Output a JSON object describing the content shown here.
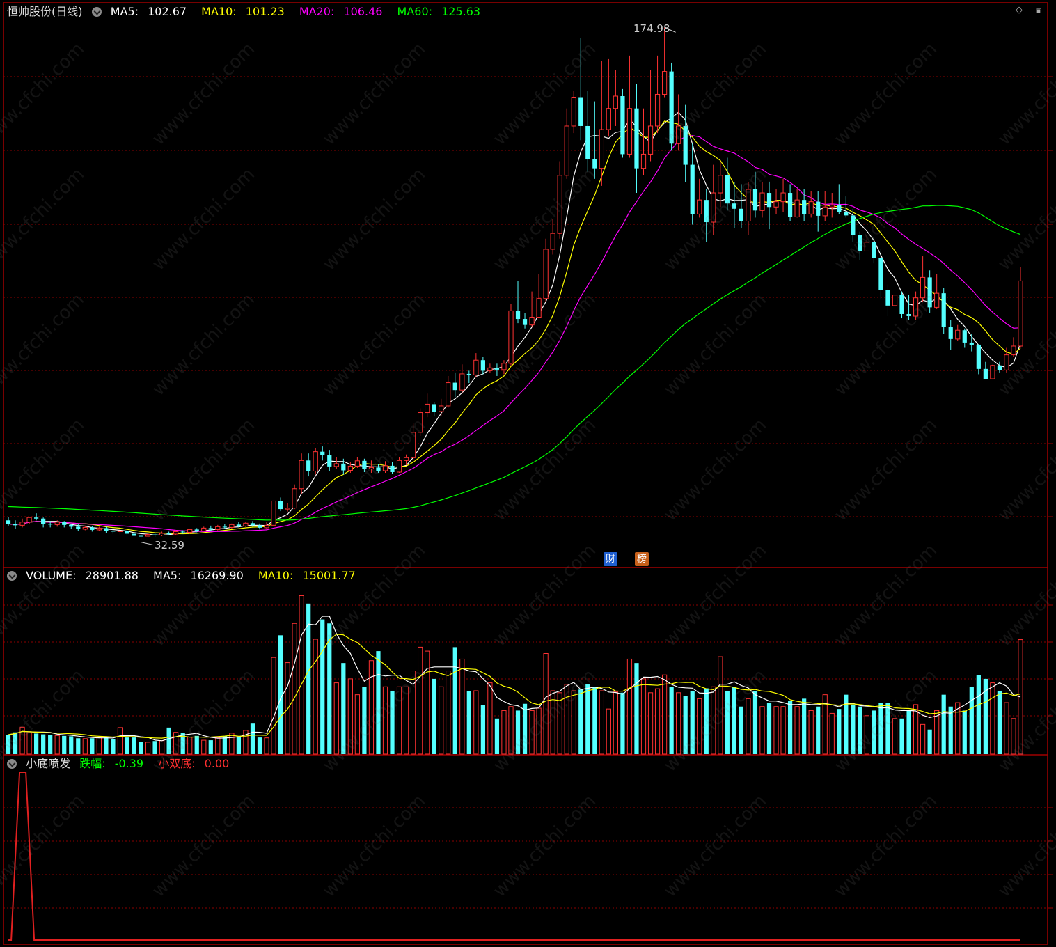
{
  "stock": {
    "title": "恒帅股份(日线)"
  },
  "price_legend": [
    {
      "label": "MA5: ",
      "value": "102.67",
      "color": "#ffffff"
    },
    {
      "label": "MA10: ",
      "value": "101.23",
      "color": "#ffff00"
    },
    {
      "label": "MA20: ",
      "value": "106.46",
      "color": "#ff00ff"
    },
    {
      "label": "MA60: ",
      "value": "125.63",
      "color": "#00ff00"
    }
  ],
  "volume_legend": [
    {
      "label": "VOLUME: ",
      "value": "28901.88",
      "color": "#ffffff"
    },
    {
      "label": "MA5: ",
      "value": "16269.90",
      "color": "#ffffff"
    },
    {
      "label": "MA10: ",
      "value": "15001.77",
      "color": "#ffff00"
    }
  ],
  "indicator_legend": {
    "name": "小底喷发",
    "items": [
      {
        "label": "跌幅: ",
        "value": "-0.39",
        "color": "#00ff00"
      },
      {
        "label": "小双底: ",
        "value": "0.00",
        "color": "#ff3030"
      }
    ]
  },
  "annotations": {
    "high": "174.98",
    "low": "32.59"
  },
  "badges": [
    {
      "text": "财",
      "color": "#1f5fd0"
    },
    {
      "text": "榜",
      "color": "#c8601a"
    }
  ],
  "watermark": "www.cfchi.com",
  "colors": {
    "up": "#ff3232",
    "down": "#54ffff",
    "grid": "#8b0000",
    "frame": "#a00000"
  },
  "chart_data": {
    "type": "candlestick",
    "price_range": [
      25,
      185
    ],
    "candles": [
      [
        38,
        37,
        39,
        36.5
      ],
      [
        37,
        36.6,
        38,
        35.5
      ],
      [
        36.6,
        37.5,
        38.5,
        36
      ],
      [
        37.5,
        38.8,
        39,
        37
      ],
      [
        38.8,
        38.5,
        40,
        38
      ],
      [
        38.5,
        37,
        38.8,
        36
      ],
      [
        37,
        36.8,
        37.8,
        36
      ],
      [
        36.8,
        37.5,
        38,
        36.2
      ],
      [
        37.5,
        36.7,
        37.8,
        36
      ],
      [
        36.7,
        36.2,
        37,
        35.5
      ],
      [
        36.2,
        35.5,
        37,
        35
      ],
      [
        35.5,
        36,
        36.5,
        35.2
      ],
      [
        36,
        35.3,
        36.4,
        34.8
      ],
      [
        35.3,
        35.8,
        36.2,
        34.9
      ],
      [
        35.8,
        35,
        36.2,
        34.5
      ],
      [
        35,
        34.8,
        35.8,
        34.2
      ],
      [
        34.8,
        35,
        35.5,
        34
      ],
      [
        35,
        34.2,
        35.2,
        33.8
      ],
      [
        34.2,
        33.6,
        34.6,
        33
      ],
      [
        33.6,
        33.5,
        34,
        32.59
      ],
      [
        33.5,
        34,
        34.5,
        33
      ],
      [
        34,
        33.8,
        34.6,
        33.3
      ],
      [
        33.8,
        34.3,
        34.8,
        33.5
      ],
      [
        34.3,
        34.1,
        34.8,
        33.8
      ],
      [
        34.1,
        34.8,
        35.2,
        33.8
      ],
      [
        34.8,
        34.6,
        35.2,
        34.2
      ],
      [
        34.6,
        35.4,
        35.6,
        34.2
      ],
      [
        35.4,
        35,
        35.8,
        34.6
      ],
      [
        35,
        35.8,
        36.2,
        34.8
      ],
      [
        35.8,
        35.4,
        36.5,
        35
      ],
      [
        35.4,
        36.2,
        36.7,
        35.1
      ],
      [
        36.2,
        36,
        37,
        35.5
      ],
      [
        36,
        36.8,
        37.1,
        35.7
      ],
      [
        36.8,
        36.4,
        37.5,
        36
      ],
      [
        36.4,
        37.2,
        37.6,
        36.1
      ],
      [
        37.2,
        36.6,
        37.8,
        36.2
      ],
      [
        36.6,
        35.9,
        37.1,
        35.4
      ],
      [
        35.9,
        36.6,
        37.5,
        35.5
      ],
      [
        36.6,
        43.5,
        43.5,
        36.6
      ],
      [
        43.5,
        41.2,
        44.5,
        40.6
      ],
      [
        41.2,
        41.5,
        42.8,
        40.5
      ],
      [
        41.5,
        47,
        48.2,
        41.2
      ],
      [
        47,
        55,
        57,
        45.5
      ],
      [
        55,
        52,
        57,
        50.5
      ],
      [
        52,
        57.5,
        58.5,
        51
      ],
      [
        57.5,
        56.5,
        59,
        55
      ],
      [
        56.5,
        53.3,
        58,
        52
      ],
      [
        53.3,
        54.1,
        56,
        52.5
      ],
      [
        54.1,
        52.2,
        55.5,
        51
      ],
      [
        52.2,
        53.4,
        54.5,
        51.5
      ],
      [
        53.4,
        54.9,
        56,
        52.9
      ],
      [
        54.9,
        52.6,
        55.5,
        51.7
      ],
      [
        52.6,
        53,
        55,
        51.5
      ],
      [
        53,
        52.1,
        54,
        51.5
      ],
      [
        52.1,
        53.5,
        54.8,
        51.5
      ],
      [
        53.5,
        51.7,
        54.5,
        51.2
      ],
      [
        51.7,
        55,
        56,
        51.5
      ],
      [
        55,
        55.8,
        56.7,
        53.7
      ],
      [
        55.8,
        63,
        65.5,
        55
      ],
      [
        63,
        68.6,
        69.8,
        62
      ],
      [
        68.6,
        71,
        74,
        67.3
      ],
      [
        71,
        68.9,
        71.5,
        67.5
      ],
      [
        68.9,
        70.5,
        72.5,
        67.5
      ],
      [
        70.5,
        77.1,
        79,
        70
      ],
      [
        77.1,
        75,
        80,
        73
      ],
      [
        75,
        79.6,
        82.3,
        74
      ],
      [
        79.6,
        79.3,
        80.5,
        77
      ],
      [
        79.3,
        83.5,
        85.5,
        78.8
      ],
      [
        83.5,
        80.5,
        84.5,
        79.5
      ],
      [
        80.5,
        81.3,
        82.5,
        80
      ],
      [
        81.3,
        80.8,
        82.5,
        79
      ],
      [
        80.8,
        82.6,
        83.5,
        79.5
      ],
      [
        82.6,
        97.5,
        99.5,
        82
      ],
      [
        97.5,
        95.2,
        106,
        94
      ],
      [
        95.2,
        93.5,
        96.8,
        92.5
      ],
      [
        93.5,
        95.7,
        103,
        93
      ],
      [
        95.7,
        101,
        108,
        95.5
      ],
      [
        101,
        115,
        118,
        100
      ],
      [
        115,
        119.5,
        123.5,
        113.5
      ],
      [
        119.5,
        136,
        140,
        118
      ],
      [
        136,
        150,
        155,
        135
      ],
      [
        150,
        158,
        160,
        148
      ],
      [
        158,
        150,
        175,
        146
      ],
      [
        150,
        140.5,
        160,
        137
      ],
      [
        140.5,
        138,
        157,
        135
      ],
      [
        138,
        149,
        168.5,
        133
      ],
      [
        149,
        155,
        169,
        147
      ],
      [
        155,
        158.5,
        166,
        150
      ],
      [
        158.5,
        142,
        160.5,
        141
      ],
      [
        142,
        155,
        170,
        141
      ],
      [
        155,
        138,
        162,
        131
      ],
      [
        138,
        142,
        155,
        136
      ],
      [
        142,
        150,
        166,
        140
      ],
      [
        150,
        159,
        170,
        148
      ],
      [
        159,
        165.5,
        178,
        158
      ],
      [
        165.5,
        145,
        168,
        143
      ],
      [
        145,
        150,
        159,
        143
      ],
      [
        150,
        139,
        156,
        134
      ],
      [
        139,
        125,
        145,
        122
      ],
      [
        125,
        129,
        135,
        124
      ],
      [
        129,
        122.7,
        132,
        117
      ],
      [
        122.7,
        131,
        139,
        119
      ],
      [
        131,
        136,
        140,
        127
      ],
      [
        136,
        128,
        141,
        126
      ],
      [
        128,
        126.5,
        134,
        121
      ],
      [
        126.5,
        123,
        133.5,
        121
      ],
      [
        123,
        132,
        134,
        119
      ],
      [
        132,
        126,
        137,
        124
      ],
      [
        126,
        131,
        134,
        124
      ],
      [
        131,
        127,
        134.2,
        120.7
      ],
      [
        127,
        128.5,
        132,
        125
      ],
      [
        128.5,
        131,
        135,
        125.5
      ],
      [
        131,
        124.2,
        133.5,
        123
      ],
      [
        124.2,
        129,
        132,
        124
      ],
      [
        129,
        125,
        132,
        123
      ],
      [
        125,
        128.5,
        131.5,
        124
      ],
      [
        128.5,
        124.5,
        131.5,
        120
      ],
      [
        124.5,
        127,
        131.5,
        123
      ],
      [
        127,
        127.5,
        131,
        124
      ],
      [
        127.5,
        125.5,
        133.5,
        125
      ],
      [
        125.5,
        124.6,
        130,
        124
      ],
      [
        124.6,
        119,
        126.5,
        117
      ],
      [
        119,
        114.5,
        120,
        112
      ],
      [
        114.5,
        117,
        119,
        116.5
      ],
      [
        117,
        112.5,
        118.5,
        111
      ],
      [
        112.5,
        103.5,
        115,
        101
      ],
      [
        103.5,
        99,
        105,
        96
      ],
      [
        99,
        102,
        104,
        100
      ],
      [
        102,
        96.6,
        103,
        95.4
      ],
      [
        96.6,
        96,
        102,
        95
      ],
      [
        96,
        101.2,
        103,
        95
      ],
      [
        101.2,
        107,
        113,
        100
      ],
      [
        107,
        98.5,
        109,
        97
      ],
      [
        98.5,
        102.5,
        108,
        98
      ],
      [
        102.5,
        93,
        104,
        91
      ],
      [
        93,
        89.5,
        95,
        86.5
      ],
      [
        89.5,
        92,
        93.5,
        89
      ],
      [
        92,
        88.5,
        92.5,
        87
      ],
      [
        88.5,
        87.9,
        91,
        86
      ],
      [
        87.9,
        81,
        88,
        79.5
      ],
      [
        81,
        78.2,
        83,
        78
      ],
      [
        78.2,
        82,
        82.2,
        79
      ],
      [
        82,
        80.7,
        83,
        80
      ],
      [
        80.7,
        85,
        87,
        80
      ],
      [
        85,
        87.5,
        90,
        84.5
      ],
      [
        87.5,
        106,
        110,
        87
      ]
    ],
    "ma5_last": 102.67,
    "ma10_last": 101.23,
    "ma20_last": 106.46,
    "ma60_last": 125.63,
    "volume": [
      4900,
      5500,
      6800,
      5400,
      5200,
      5000,
      4900,
      4700,
      4600,
      4500,
      4000,
      3900,
      4000,
      4200,
      4400,
      3800,
      6700,
      4200,
      4200,
      3000,
      3000,
      3300,
      3400,
      6700,
      5500,
      5300,
      4300,
      4600,
      3500,
      3500,
      4200,
      4500,
      5300,
      4400,
      6000,
      7700,
      4200,
      4100,
      24400,
      30000,
      23100,
      33000,
      40000,
      38000,
      29000,
      34000,
      33000,
      18000,
      23000,
      19000,
      15000,
      17000,
      23600,
      26000,
      17000,
      16000,
      17000,
      17000,
      21000,
      27000,
      26000,
      19000,
      17000,
      21000,
      27000,
      24000,
      16000,
      16000,
      12400,
      18000,
      9000,
      11000,
      12000,
      11000,
      12700,
      11000,
      11600,
      25400,
      16000,
      15500,
      17600,
      16000,
      16300,
      17700,
      17000,
      16000,
      11400,
      15700,
      15500,
      24000,
      23000,
      19000,
      15500,
      16500,
      20000,
      17000,
      15500,
      14700,
      16000,
      14000,
      16600,
      17000,
      24600,
      16000,
      17000,
      12000,
      14000,
      16000,
      12000,
      13000,
      12000,
      12000,
      13500,
      12000,
      14000,
      11000,
      12000,
      15000,
      10300,
      11400,
      15000,
      12500,
      12000,
      9700,
      11000,
      13000,
      13000,
      9000,
      9000,
      11000,
      12500,
      7500,
      6200,
      11000,
      15000,
      12000,
      13000,
      11000,
      17000,
      20000,
      19000,
      18000,
      16000,
      13000,
      9000,
      16000,
      11500,
      12000,
      12000,
      15500,
      14000,
      14400,
      15000,
      28902
    ],
    "volume_range": [
      0,
      45000
    ],
    "indicator": {
      "name": "小底喷发",
      "signal_index": 2,
      "range": [
        0,
        1
      ]
    }
  }
}
